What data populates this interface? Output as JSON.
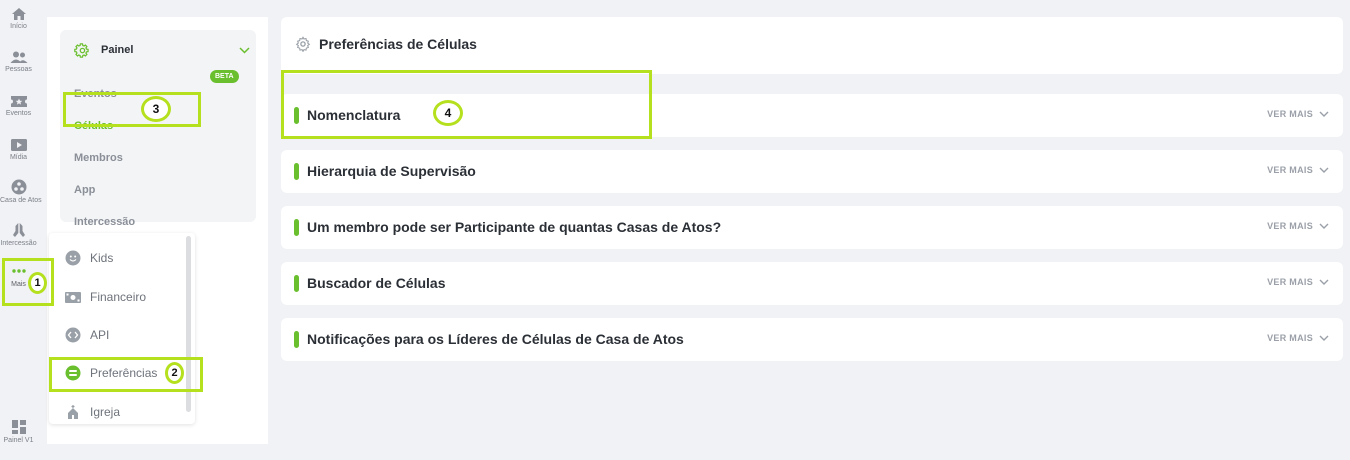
{
  "rail": {
    "items": [
      {
        "label": "Início",
        "icon": "home-icon"
      },
      {
        "label": "Pessoas",
        "icon": "people-icon"
      },
      {
        "label": "Eventos",
        "icon": "ticket-icon"
      },
      {
        "label": "Mídia",
        "icon": "play-icon"
      },
      {
        "label": "Casa de Atos",
        "icon": "group-icon"
      },
      {
        "label": "Intercessão",
        "icon": "praying-hands-icon"
      },
      {
        "label": "Mais",
        "icon": "dots-icon"
      },
      {
        "label": "Painel V1",
        "icon": "dashboard-icon"
      }
    ]
  },
  "panel": {
    "title": "Painel",
    "items": [
      {
        "label": "Eventos"
      },
      {
        "label": "Células"
      },
      {
        "label": "Membros"
      },
      {
        "label": "App"
      },
      {
        "label": "Intercessão"
      }
    ],
    "beta_label": "BETA"
  },
  "more_menu": {
    "items": [
      {
        "label": "Kids",
        "icon": "kids-icon"
      },
      {
        "label": "Financeiro",
        "icon": "money-icon"
      },
      {
        "label": "API",
        "icon": "code-icon"
      },
      {
        "label": "Preferências",
        "icon": "toggle-icon"
      },
      {
        "label": "Igreja",
        "icon": "church-icon"
      }
    ]
  },
  "main": {
    "title": "Preferências de Células",
    "rows": [
      {
        "title": "Nomenclatura",
        "action": "VER MAIS"
      },
      {
        "title": "Hierarquia de Supervisão",
        "action": "VER MAIS"
      },
      {
        "title": "Um membro pode ser Participante de quantas Casas de Atos?",
        "action": "VER MAIS"
      },
      {
        "title": "Buscador de Células",
        "action": "VER MAIS"
      },
      {
        "title": "Notificações para os Líderes de Células de Casa de Atos",
        "action": "VER MAIS"
      }
    ]
  },
  "annotations": {
    "step1": "1",
    "step2": "2",
    "step3": "3",
    "step4": "4"
  },
  "colors": {
    "accent": "#6abf2e",
    "highlight": "#b5e01e",
    "background": "#f1f2f5"
  }
}
